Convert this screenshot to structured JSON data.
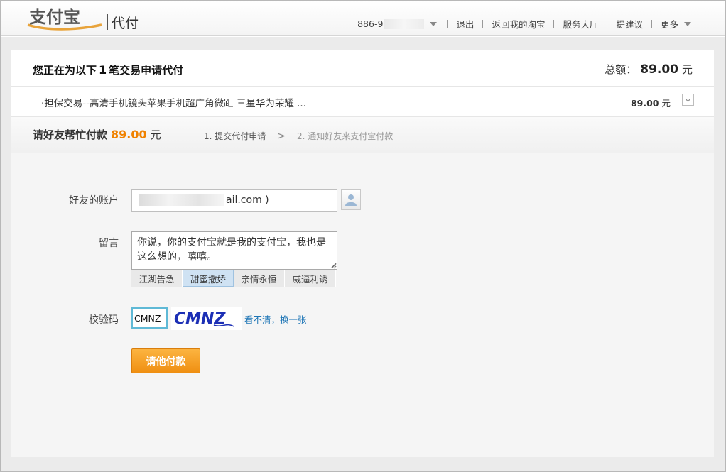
{
  "header": {
    "logo_text": "支付宝",
    "product": "代付",
    "account": "886-9",
    "nav": [
      "退出",
      "返回我的淘宝",
      "服务大厅",
      "提建议",
      "更多"
    ]
  },
  "summary": {
    "title_prefix": "您正在为以下",
    "count": "1",
    "title_suffix": "笔交易申请代付",
    "total_label": "总额：",
    "total_amount": "89.00",
    "currency": "元"
  },
  "order": {
    "name": "·担保交易--高清手机镜头苹果手机超广角微距 三星华为荣耀 ...",
    "amount": "89.00",
    "currency": "元"
  },
  "steps": {
    "ask_prefix": "请好友帮忙付款",
    "ask_amount": "89.00",
    "ask_currency": "元",
    "step1": "1. 提交代付申请",
    "arrow": ">",
    "step2": "2. 通知好友来支付宝付款"
  },
  "form": {
    "account_label": "好友的账户",
    "account_value_suffix": "ail.com )",
    "message_label": "留言",
    "message_value": "你说，你的支付宝就是我的支付宝，我也是这么想的，嘻嘻。",
    "templates": [
      "江湖告急",
      "甜蜜撒娇",
      "亲情永恒",
      "威逼利诱"
    ],
    "active_template": "甜蜜撒娇",
    "code_label": "校验码",
    "code_value": "CMNZ",
    "captcha_text": "CMNZ",
    "refresh_link": "看不清，换一张",
    "submit_label": "请他付款"
  },
  "colors": {
    "accent_orange": "#f08200",
    "link_blue": "#1f76b6",
    "button_orange": "#f5a023"
  }
}
